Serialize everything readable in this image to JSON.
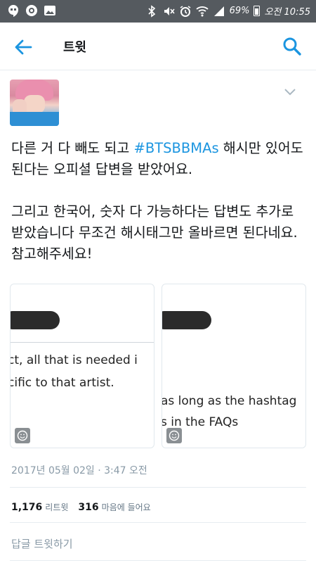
{
  "status_bar": {
    "battery_percent": "69%",
    "time": "오전 10:55",
    "left_icons": [
      "hangouts-icon",
      "camera-icon",
      "gallery-icon"
    ],
    "right_icons": [
      "bluetooth-icon",
      "mute-icon",
      "alarm-icon",
      "wifi-icon",
      "signal-icon",
      "battery-icon"
    ]
  },
  "app_bar": {
    "title": "트윗",
    "back_icon": "arrow-left-icon",
    "search_icon": "search-icon"
  },
  "tweet": {
    "text_part1": "다른 거 다 빼도 되고 ",
    "hashtag": "#BTSBBMAs",
    "text_part2": " 해시만 있어도 된다는 오피셜 답변을 받았어요.\n\n그리고 한국어, 숫자 다 가능하다는 답변도 추가로 받았습니다 무조건 해시태그만 올바르면 된다네요. 참고해주세요!",
    "media": [
      {
        "line1": "ct, all that is needed i",
        "line2": "cific to that artist."
      },
      {
        "line1": "as long as the hashtag",
        "line2": "s in the FAQs"
      }
    ],
    "timestamp": "2017년 05월 02일 · 3:47 오전",
    "retweets_count": "1,176",
    "retweets_label": "리트윗",
    "likes_count": "316",
    "likes_label": "마음에 들어요",
    "reply_label": "답글 트윗하기"
  },
  "colors": {
    "accent": "#1b95e0",
    "status_bar_bg": "#555a5f",
    "muted_text": "#8899a6"
  }
}
